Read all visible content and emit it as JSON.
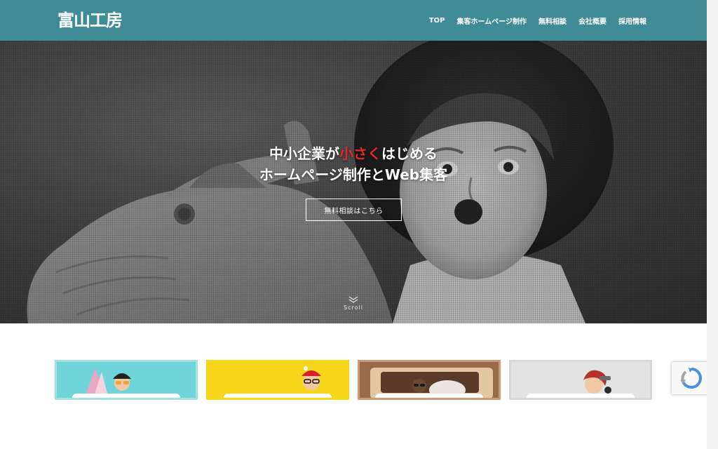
{
  "header": {
    "logo": "富山工房",
    "nav": [
      "TOP",
      "集客ホームページ制作",
      "無料相談",
      "会社概要",
      "採用情報"
    ]
  },
  "hero": {
    "title_line1_pre": "中小企業が",
    "title_line1_accent": "小さく",
    "title_line1_post": "はじめる",
    "title_line2": "ホームページ制作とWeb集客",
    "cta_label": "無料相談はこちら",
    "scroll_label": "Scroll"
  },
  "colors": {
    "header_bg": "#3f8c96",
    "accent_red": "#e8272d",
    "card1_border": "#a6dfe0",
    "card2_border": "#f8d61a",
    "card3_border": "#c99a74",
    "card4_border": "#d8d8d8"
  },
  "icons": {
    "scroll": "double-chevron-down-icon",
    "recaptcha": "recaptcha-icon"
  }
}
